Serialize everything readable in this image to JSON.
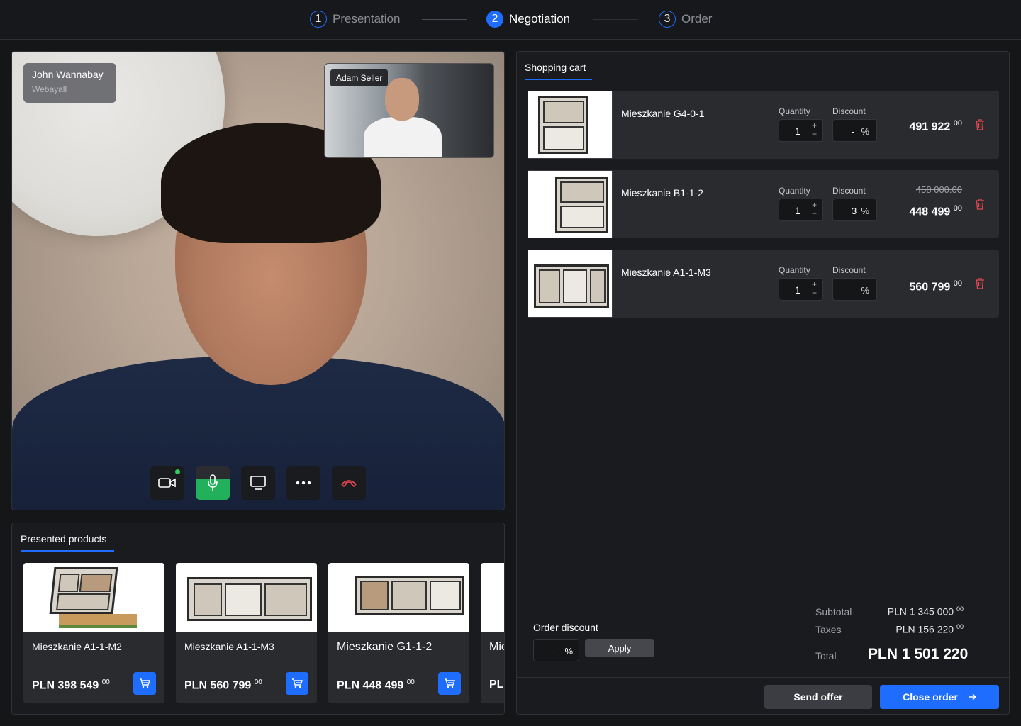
{
  "stepper": {
    "steps": [
      {
        "num": "1",
        "label": "Presentation"
      },
      {
        "num": "2",
        "label": "Negotiation"
      },
      {
        "num": "3",
        "label": "Order"
      }
    ]
  },
  "video": {
    "caller": {
      "name": "John Wannabay",
      "company": "Webayall"
    },
    "pip_name": "Adam Seller",
    "controls": [
      "camera-icon",
      "microphone-icon",
      "screen-share-icon",
      "more-icon",
      "hang-up-icon"
    ]
  },
  "presented": {
    "tab_label": "Presented products",
    "items": [
      {
        "title": "Mieszkanie A1-1-M2",
        "price": "PLN 398 549",
        "cents": "00"
      },
      {
        "title": "Mieszkanie A1-1-M3",
        "price": "PLN 560 799",
        "cents": "00"
      },
      {
        "title": "Mieszkanie G1-1-2",
        "price": "PLN 448 499",
        "cents": "00"
      },
      {
        "title": "Mie",
        "price": "PLI",
        "cents": ""
      }
    ]
  },
  "cart": {
    "tab_label": "Shopping cart",
    "quantity_label": "Quantity",
    "discount_label": "Discount",
    "items": [
      {
        "name": "Mieszkanie G4-0-1",
        "qty": "1",
        "discount": "-",
        "old_price": "",
        "price": "491 922",
        "cents": "00"
      },
      {
        "name": "Mieszkanie B1-1-2",
        "qty": "1",
        "discount": "3",
        "old_price": "458 000.00",
        "price": "448 499",
        "cents": "00"
      },
      {
        "name": "Mieszkanie A1-1-M3",
        "qty": "1",
        "discount": "-",
        "old_price": "",
        "price": "560 799",
        "cents": "00"
      }
    ],
    "order_discount": {
      "label": "Order discount",
      "value": "-",
      "unit": "%",
      "apply_label": "Apply"
    },
    "summary": {
      "subtotal_label": "Subtotal",
      "subtotal": "PLN 1 345 000",
      "subtotal_cents": "00",
      "taxes_label": "Taxes",
      "taxes": "PLN 156 220",
      "taxes_cents": "00",
      "total_label": "Total",
      "total": "PLN 1 501 220"
    },
    "send_offer_label": "Send offer",
    "close_order_label": "Close order"
  },
  "colors": {
    "accent": "#1e6dff",
    "mic_active": "#23b05a",
    "danger": "#e5484d"
  }
}
